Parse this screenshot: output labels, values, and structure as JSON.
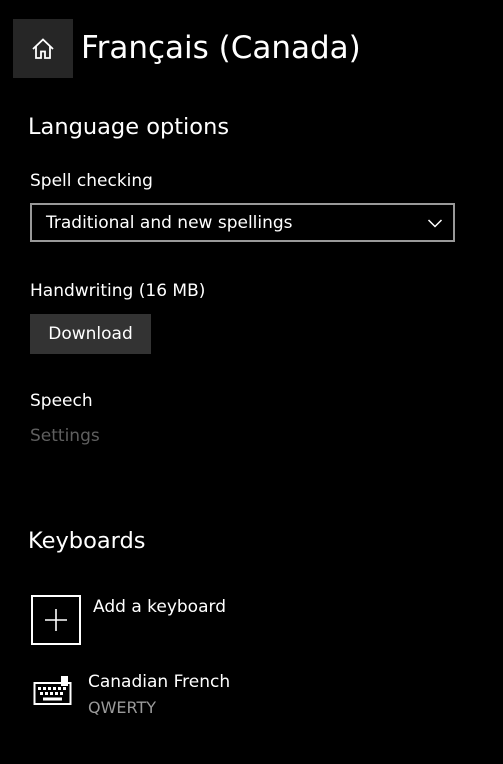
{
  "header": {
    "home_icon": "home-icon",
    "title": "Français (Canada)"
  },
  "language_options": {
    "heading": "Language options",
    "spell_checking": {
      "label": "Spell checking",
      "selected": "Traditional and new spellings",
      "icon": "chevron-down-icon"
    },
    "handwriting": {
      "label": "Handwriting (16 MB)",
      "button_label": "Download"
    },
    "speech": {
      "label": "Speech",
      "settings_link": "Settings"
    }
  },
  "keyboards": {
    "heading": "Keyboards",
    "add": {
      "icon": "plus-icon",
      "label": "Add a keyboard"
    },
    "items": [
      {
        "icon": "keyboard-icon",
        "name": "Canadian French",
        "layout": "QWERTY"
      }
    ]
  },
  "colors": {
    "background": "#000000",
    "text": "#ffffff",
    "button_bg": "#333333",
    "home_bg": "#262626",
    "disabled_text": "#5f5f5f",
    "secondary_text": "#9a9a9a",
    "dropdown_border": "#999999"
  }
}
